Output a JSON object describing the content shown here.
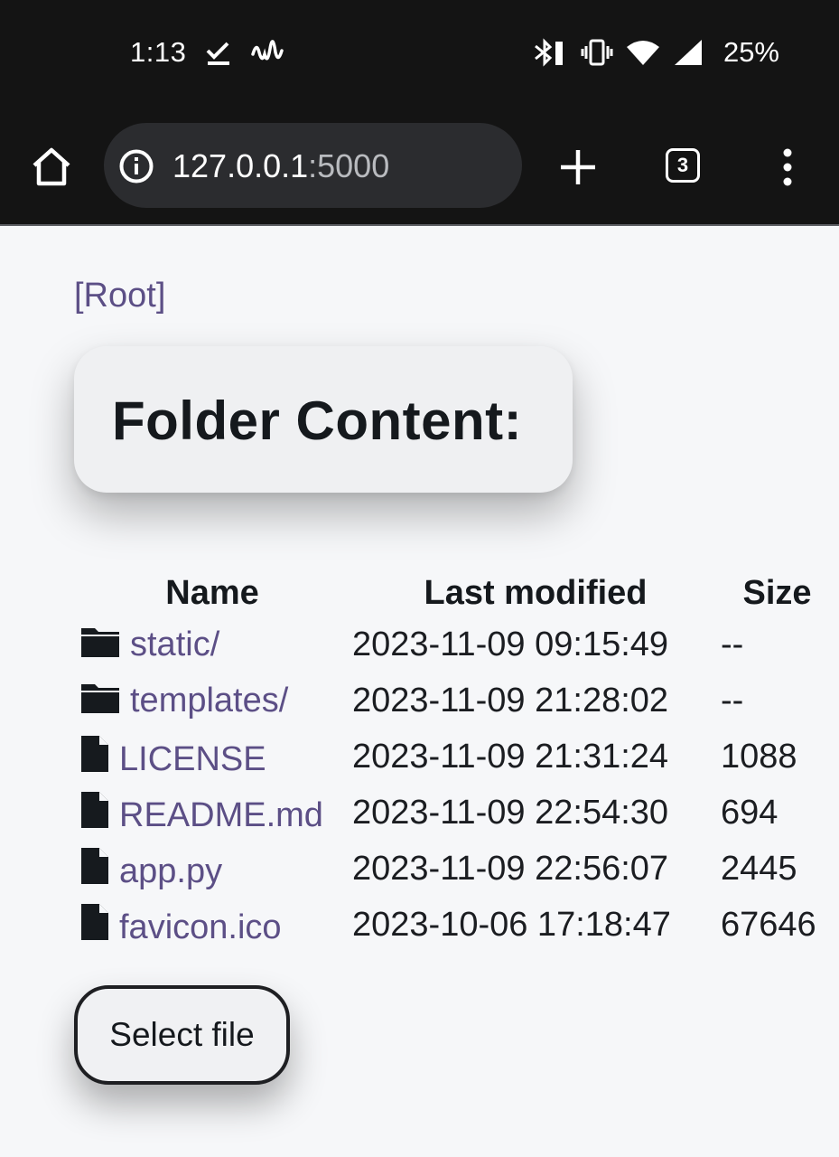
{
  "status_bar": {
    "time": "1:13",
    "battery": "25%"
  },
  "browser": {
    "url_host": "127.0.0.1",
    "url_port": ":5000",
    "tab_count": "3"
  },
  "page": {
    "root_link": "[Root]",
    "heading": "Folder Content:",
    "columns": {
      "name": "Name",
      "modified": "Last modified",
      "size": "Size"
    },
    "entries": [
      {
        "name": "static/",
        "modified": "2023-11-09 09:15:49",
        "size": "--",
        "icon": "folder-icon"
      },
      {
        "name": "templates/",
        "modified": "2023-11-09 21:28:02",
        "size": "--",
        "icon": "folder-icon"
      },
      {
        "name": "LICENSE",
        "modified": "2023-11-09 21:31:24",
        "size": "1088",
        "icon": "file-icon"
      },
      {
        "name": "README.md",
        "modified": "2023-11-09 22:54:30",
        "size": "694",
        "icon": "file-icon"
      },
      {
        "name": "app.py",
        "modified": "2023-11-09 22:56:07",
        "size": "2445",
        "icon": "file-icon"
      },
      {
        "name": "favicon.ico",
        "modified": "2023-10-06 17:18:47",
        "size": "67646",
        "icon": "file-icon"
      }
    ],
    "select_button": "Select file"
  },
  "colors": {
    "link": "#5c4f86",
    "chrome": "#141414",
    "page_bg": "#f6f7f9"
  }
}
